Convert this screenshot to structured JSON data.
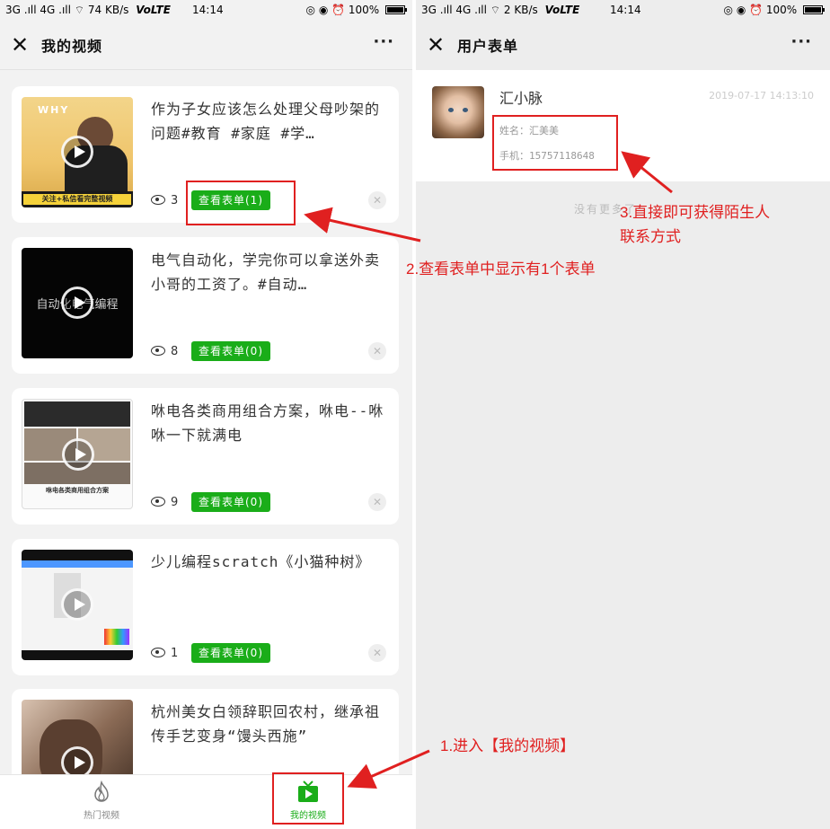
{
  "left_phone": {
    "status": {
      "signal": "3G .ıll 4G .ıll",
      "speed": "74 KB/s",
      "volte": "VoLTE",
      "time": "14:14",
      "battery": "100%"
    },
    "nav": {
      "title": "我的视频",
      "more": "···"
    },
    "videos": [
      {
        "title": "作为子女应该怎么处理父母吵架的问题#教育 #家庭 #学…",
        "views": "3",
        "form_button": "查看表单(1)",
        "thumb_caption": "关注+私信看完整视频"
      },
      {
        "title": "电气自动化，学完你可以拿送外卖小哥的工资了。#自动…",
        "views": "8",
        "form_button": "查看表单(0)",
        "thumb_caption": "自动化电气编程"
      },
      {
        "title": "咻电各类商用组合方案，咻电--咻咻一下就满电",
        "views": "9",
        "form_button": "查看表单(0)",
        "thumb_caption": "咻电各类商用组合方案"
      },
      {
        "title": "少儿编程scratch《小猫种树》",
        "views": "1",
        "form_button": "查看表单(0)"
      },
      {
        "title": "杭州美女白领辞职回农村，继承祖传手艺变身“馒头西施”"
      }
    ],
    "tabs": [
      {
        "label": "热门视频",
        "icon": "flame-icon"
      },
      {
        "label": "我的视频",
        "icon": "video-play-icon",
        "active": true
      }
    ]
  },
  "right_phone": {
    "status": {
      "signal": "3G .ıll 4G .ıll",
      "speed": "2 KB/s",
      "volte": "VoLTE",
      "time": "14:14",
      "battery": "100%"
    },
    "nav": {
      "title": "用户表单",
      "more": "···"
    },
    "entry": {
      "name": "汇小脉",
      "date": "2019-07-17 14:13:10",
      "field_name": "姓名：汇美美",
      "field_phone": "手机：15757118648"
    },
    "no_more": "没有更多了"
  },
  "annotations": {
    "step1": "1.进入【我的视频】",
    "step2": "2.查看表单中显示有1个表单",
    "step3_line1": "3.直接即可获得陌生人",
    "step3_line2": "联系方式"
  },
  "colors": {
    "accent_green": "#1aad19",
    "annotation_red": "#e02020"
  }
}
